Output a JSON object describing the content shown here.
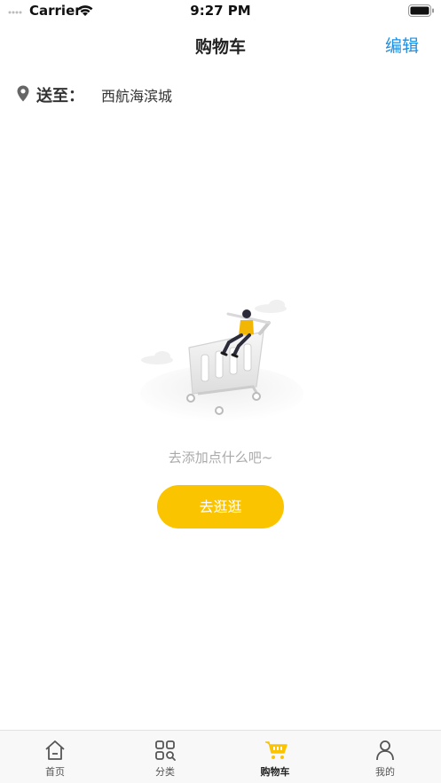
{
  "status_bar": {
    "carrier": "Carrier",
    "time": "9:27 PM"
  },
  "nav": {
    "title": "购物车",
    "edit_label": "编辑"
  },
  "delivery": {
    "label": "送至：",
    "address": "西航海滨城"
  },
  "empty_state": {
    "message": "去添加点什么吧~",
    "button_label": "去逛逛"
  },
  "tab_bar": {
    "active_index": 2,
    "tabs": [
      {
        "label": "首页",
        "icon": "home-icon"
      },
      {
        "label": "分类",
        "icon": "category-icon"
      },
      {
        "label": "购物车",
        "icon": "cart-icon"
      },
      {
        "label": "我的",
        "icon": "profile-icon"
      }
    ]
  },
  "colors": {
    "accent": "#fbc400",
    "link": "#1a8fe3",
    "muted_text": "#aaaaaa"
  }
}
